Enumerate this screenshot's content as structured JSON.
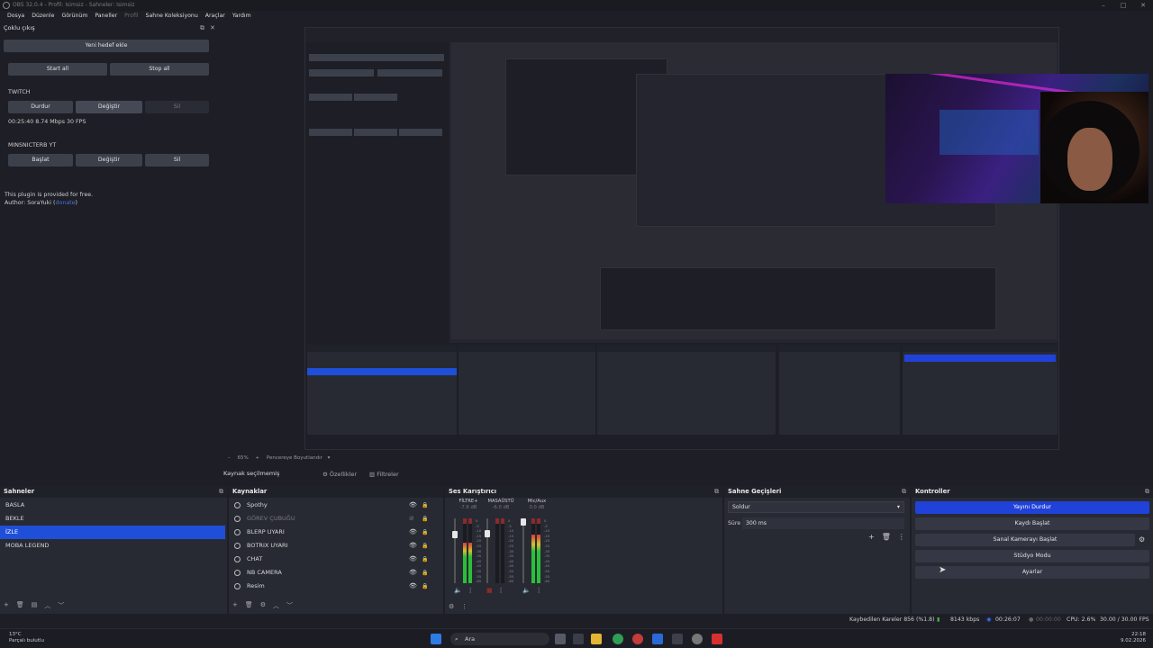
{
  "window": {
    "title": "OBS 32.0.4 - Profil: Isimsiz - Sahneler: Isimsiz"
  },
  "menu": [
    "Dosya",
    "Düzenle",
    "Görünüm",
    "Paneller",
    "Profil",
    "Sahne Koleksiyonu",
    "Araçlar",
    "Yardım"
  ],
  "multi": {
    "title": "Çoklu çıkış",
    "add_target": "Yeni hedef ekle",
    "start_all": "Start all",
    "stop_all": "Stop all",
    "twitch": {
      "name": "TWITCH",
      "stop": "Durdur",
      "edit": "Değiştir",
      "delete": "Sil",
      "stats": "00:25:40  8.74 Mbps  30 FPS"
    },
    "yt": {
      "name": "MINSNICTERB YT",
      "start": "Başlat",
      "edit": "Değiştir",
      "delete": "Sil"
    },
    "plugin_note": "This plugin is provided for free.",
    "author_label": "Author: SoraYuki (",
    "author_link": "donate",
    "author_close": ")"
  },
  "statusrow": {
    "zoom": "65%",
    "fit": "Pencereye Boyutlandır"
  },
  "sourcebar": {
    "none_selected": "Kaynak seçilmemiş",
    "properties": "Özellikler",
    "filters": "Filtreler"
  },
  "scenes": {
    "title": "Sahneler",
    "items": [
      {
        "label": "BASLA",
        "selected": false
      },
      {
        "label": "BEKLE",
        "selected": false
      },
      {
        "label": "İZLE",
        "selected": true
      },
      {
        "label": "MOBA LEGEND",
        "selected": false
      }
    ]
  },
  "sources": {
    "title": "Kaynaklar",
    "items": [
      {
        "label": "Spothy",
        "visible": true
      },
      {
        "label": "GÖREV ÇUBUĞU",
        "visible": false
      },
      {
        "label": "BLERP UYARI",
        "visible": true
      },
      {
        "label": "BOTRIX UYARI",
        "visible": true
      },
      {
        "label": "CHAT",
        "visible": true
      },
      {
        "label": "NB CAMERA",
        "visible": true
      },
      {
        "label": "Resim",
        "visible": true
      }
    ]
  },
  "mixer": {
    "title": "Ses Karıştırıcı",
    "channels": [
      {
        "name": "FİLTRE+",
        "db": "-7.6 dB",
        "level": 0.62,
        "fader": 0.78
      },
      {
        "name": "MASAÜSTÜ",
        "db": "-6.0 dB",
        "level": 0.0,
        "fader": 0.8
      },
      {
        "name": "Mic/Aux",
        "db": "0.0 dB",
        "level": 0.75,
        "fader": 1.0
      }
    ],
    "scale": [
      "0",
      "-5",
      "-10",
      "-15",
      "-20",
      "-25",
      "-30",
      "-35",
      "-40",
      "-45",
      "-50",
      "-55",
      "-60"
    ]
  },
  "transitions": {
    "title": "Sahne Geçişleri",
    "selected": "Soldur",
    "duration_label": "Süre",
    "duration_value": "300 ms"
  },
  "controls": {
    "title": "Kontroller",
    "stop_stream": "Yayını Durdur",
    "start_record": "Kaydı Başlat",
    "virtual_cam": "Sanal Kamerayı Başlat",
    "studio_mode": "Stüdyo Modu",
    "settings": "Ayarlar"
  },
  "obs_status": {
    "dropped": "Kaybedilen Kareler 856 (%1.8)",
    "bitrate": "8143 kbps",
    "stream_time": "00:26:07",
    "rec_time": "00:00:00",
    "cpu": "CPU: 2.6%",
    "fps": "30.00 / 30.00 FPS"
  },
  "taskbar": {
    "temp": "13°C",
    "weather": "Parçalı bulutlu",
    "search": "Ara",
    "time": "22:18",
    "date": "9.02.2026"
  },
  "colors": {
    "accent": "#1f4fd8",
    "active_button": "#2142d8",
    "panel": "#272a33",
    "bg": "#1d1e26"
  }
}
